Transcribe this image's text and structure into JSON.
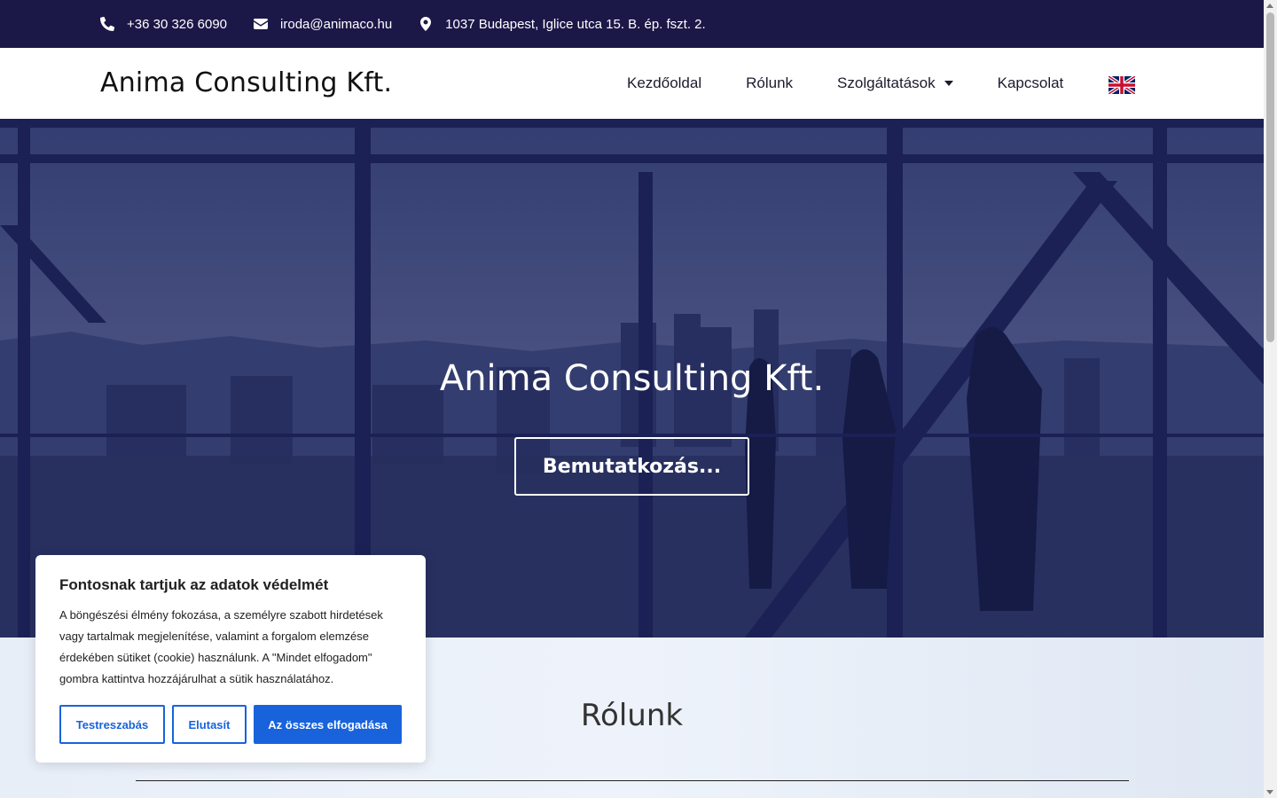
{
  "topbar": {
    "phone": "+36 30 326 6090",
    "email": "iroda@animaco.hu",
    "address": "1037 Budapest, Iglice utca 15. B. ép. fszt. 2."
  },
  "header": {
    "brand": "Anima Consulting Kft.",
    "nav": [
      "Kezdőoldal",
      "Rólunk",
      "Szolgáltatások",
      "Kapcsolat"
    ],
    "language_flag": "uk-flag-icon"
  },
  "hero": {
    "title": "Anima Consulting Kft.",
    "button": "Bemutatkozás..."
  },
  "about": {
    "title": "Rólunk"
  },
  "cookie": {
    "title": "Fontosnak tartjuk az adatok védelmét",
    "text": "A böngészési élmény fokozása, a személyre szabott hirdetések vagy tartalmak megjelenítése, valamint a forgalom elemzése érdekében sütiket (cookie) használunk. A \"Mindet elfogadom\" gombra kattintva hozzájárulhat a sütik használatához.",
    "btn_customize": "Testreszabás",
    "btn_reject": "Elutasít",
    "btn_accept": "Az összes elfogadása"
  },
  "colors": {
    "topbar_bg": "#1b1848",
    "accent": "#1863dc"
  }
}
